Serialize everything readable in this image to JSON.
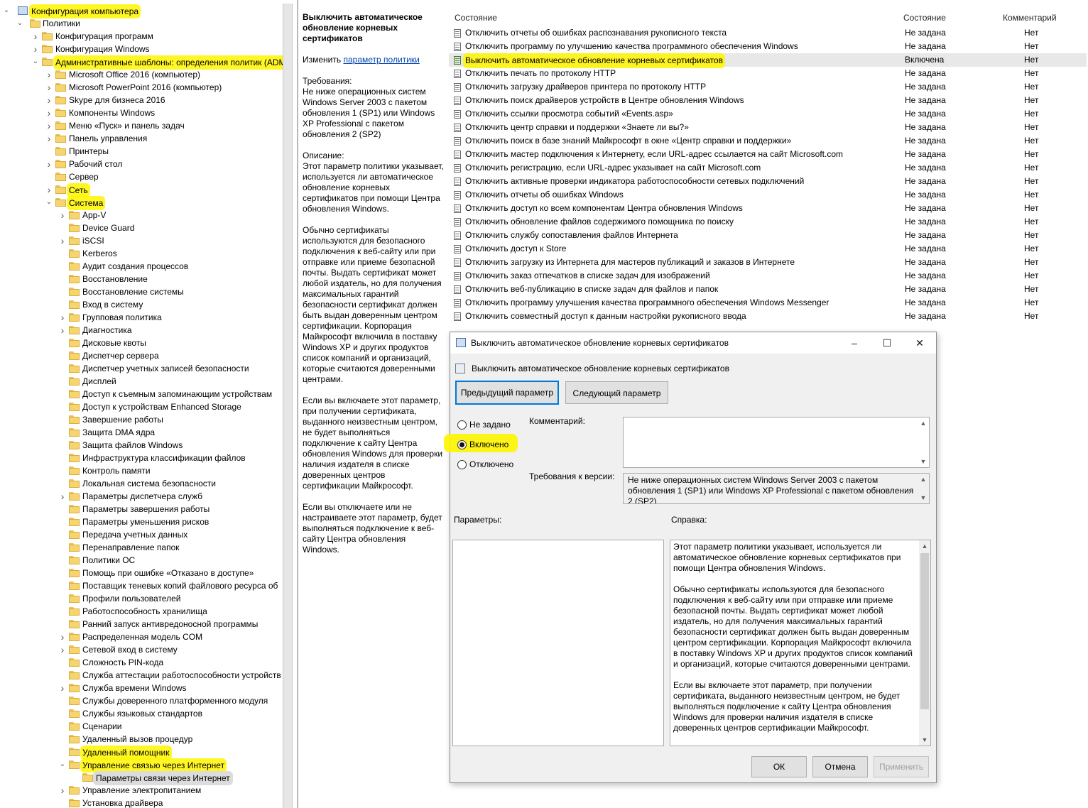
{
  "tree": {
    "root": "Конфигурация компьютера",
    "policies": "Политики",
    "items": [
      {
        "label": "Конфигурация программ",
        "level": 2,
        "chev": "right",
        "hl": false
      },
      {
        "label": "Конфигурация Windows",
        "level": 2,
        "chev": "right",
        "hl": false
      },
      {
        "label": "Административные шаблоны: определения политик (ADM",
        "level": 2,
        "chev": "down",
        "hl": true
      },
      {
        "label": "Microsoft Office 2016 (компьютер)",
        "level": 3,
        "chev": "right",
        "hl": false
      },
      {
        "label": "Microsoft PowerPoint 2016 (компьютер)",
        "level": 3,
        "chev": "right",
        "hl": false
      },
      {
        "label": "Skype для бизнеса 2016",
        "level": 3,
        "chev": "right",
        "hl": false
      },
      {
        "label": "Компоненты Windows",
        "level": 3,
        "chev": "right",
        "hl": false
      },
      {
        "label": "Меню «Пуск» и панель задач",
        "level": 3,
        "chev": "right",
        "hl": false
      },
      {
        "label": "Панель управления",
        "level": 3,
        "chev": "right",
        "hl": false
      },
      {
        "label": "Принтеры",
        "level": 3,
        "chev": "",
        "hl": false
      },
      {
        "label": "Рабочий стол",
        "level": 3,
        "chev": "right",
        "hl": false
      },
      {
        "label": "Сервер",
        "level": 3,
        "chev": "",
        "hl": false
      },
      {
        "label": "Сеть",
        "level": 3,
        "chev": "right",
        "hl": true
      },
      {
        "label": "Система",
        "level": 3,
        "chev": "down",
        "hl": true
      },
      {
        "label": "App-V",
        "level": 4,
        "chev": "right",
        "hl": false
      },
      {
        "label": "Device Guard",
        "level": 4,
        "chev": "",
        "hl": false
      },
      {
        "label": "iSCSI",
        "level": 4,
        "chev": "right",
        "hl": false
      },
      {
        "label": "Kerberos",
        "level": 4,
        "chev": "",
        "hl": false
      },
      {
        "label": "Аудит создания процессов",
        "level": 4,
        "chev": "",
        "hl": false
      },
      {
        "label": "Восстановление",
        "level": 4,
        "chev": "",
        "hl": false
      },
      {
        "label": "Восстановление системы",
        "level": 4,
        "chev": "",
        "hl": false
      },
      {
        "label": "Вход в систему",
        "level": 4,
        "chev": "",
        "hl": false
      },
      {
        "label": "Групповая политика",
        "level": 4,
        "chev": "right",
        "hl": false
      },
      {
        "label": "Диагностика",
        "level": 4,
        "chev": "right",
        "hl": false
      },
      {
        "label": "Дисковые квоты",
        "level": 4,
        "chev": "",
        "hl": false
      },
      {
        "label": "Диспетчер сервера",
        "level": 4,
        "chev": "",
        "hl": false
      },
      {
        "label": "Диспетчер учетных записей безопасности",
        "level": 4,
        "chev": "",
        "hl": false
      },
      {
        "label": "Дисплей",
        "level": 4,
        "chev": "",
        "hl": false
      },
      {
        "label": "Доступ к съемным запоминающим устройствам",
        "level": 4,
        "chev": "",
        "hl": false
      },
      {
        "label": "Доступ к устройствам Enhanced Storage",
        "level": 4,
        "chev": "",
        "hl": false
      },
      {
        "label": "Завершение работы",
        "level": 4,
        "chev": "",
        "hl": false
      },
      {
        "label": "Защита DMA ядра",
        "level": 4,
        "chev": "",
        "hl": false
      },
      {
        "label": "Защита файлов Windows",
        "level": 4,
        "chev": "",
        "hl": false
      },
      {
        "label": "Инфраструктура классификации файлов",
        "level": 4,
        "chev": "",
        "hl": false
      },
      {
        "label": "Контроль памяти",
        "level": 4,
        "chev": "",
        "hl": false
      },
      {
        "label": "Локальная система безопасности",
        "level": 4,
        "chev": "",
        "hl": false
      },
      {
        "label": "Параметры диспетчера служб",
        "level": 4,
        "chev": "right",
        "hl": false
      },
      {
        "label": "Параметры завершения работы",
        "level": 4,
        "chev": "",
        "hl": false
      },
      {
        "label": "Параметры уменьшения рисков",
        "level": 4,
        "chev": "",
        "hl": false
      },
      {
        "label": "Передача учетных данных",
        "level": 4,
        "chev": "",
        "hl": false
      },
      {
        "label": "Перенаправление папок",
        "level": 4,
        "chev": "",
        "hl": false
      },
      {
        "label": "Политики ОС",
        "level": 4,
        "chev": "",
        "hl": false
      },
      {
        "label": "Помощь при ошибке «Отказано в доступе»",
        "level": 4,
        "chev": "",
        "hl": false
      },
      {
        "label": "Поставщик теневых копий файлового ресурса об",
        "level": 4,
        "chev": "",
        "hl": false
      },
      {
        "label": "Профили пользователей",
        "level": 4,
        "chev": "",
        "hl": false
      },
      {
        "label": "Работоспособность хранилища",
        "level": 4,
        "chev": "",
        "hl": false
      },
      {
        "label": "Ранний запуск антивредоносной программы",
        "level": 4,
        "chev": "",
        "hl": false
      },
      {
        "label": "Распределенная модель COM",
        "level": 4,
        "chev": "right",
        "hl": false
      },
      {
        "label": "Сетевой вход в систему",
        "level": 4,
        "chev": "right",
        "hl": false
      },
      {
        "label": "Сложность PIN-кода",
        "level": 4,
        "chev": "",
        "hl": false
      },
      {
        "label": "Служба аттестации работоспособности устройств",
        "level": 4,
        "chev": "",
        "hl": false
      },
      {
        "label": "Служба времени Windows",
        "level": 4,
        "chev": "right",
        "hl": false
      },
      {
        "label": "Службы доверенного платформенного модуля",
        "level": 4,
        "chev": "",
        "hl": false
      },
      {
        "label": "Службы языковых стандартов",
        "level": 4,
        "chev": "",
        "hl": false
      },
      {
        "label": "Сценарии",
        "level": 4,
        "chev": "",
        "hl": false
      },
      {
        "label": "Удаленный вызов процедур",
        "level": 4,
        "chev": "",
        "hl": false
      },
      {
        "label": "Удаленный помощник",
        "level": 4,
        "chev": "",
        "hl": true
      },
      {
        "label": "Управление связью через Интернет",
        "level": 4,
        "chev": "down",
        "hl": true
      },
      {
        "label": "Параметры связи через Интернет",
        "level": 5,
        "chev": "",
        "hl": true,
        "sel": true
      },
      {
        "label": "Управление электропитанием",
        "level": 4,
        "chev": "right",
        "hl": false
      },
      {
        "label": "Установка драйвера",
        "level": 4,
        "chev": "",
        "hl": false
      }
    ]
  },
  "description": {
    "title": "Выключить автоматическое обновление корневых сертификатов",
    "edit_prefix": "Изменить",
    "edit_link": "параметр политики",
    "req_label": "Требования:",
    "req_text": "Не ниже операционных систем Windows Server 2003 с пакетом обновления 1 (SP1) или Windows XP Professional с пакетом обновления 2 (SP2)",
    "desc_label": "Описание:",
    "p1": "Этот параметр политики указывает, используется ли автоматическое обновление корневых сертификатов при помощи Центра обновления Windows.",
    "p2": "Обычно сертификаты используются для безопасного подключения к веб-сайту или при отправке или приеме безопасной почты. Выдать сертификат может любой издатель, но для получения максимальных гарантий безопасности сертификат должен быть выдан доверенным центром сертификации. Корпорация Майкрософт включила в поставку Windows XP и других продуктов список компаний и организаций, которые считаются доверенными центрами.",
    "p3": "Если вы включаете этот параметр, при получении сертификата, выданного неизвестным центром, не будет выполняться подключение к сайту Центра обновления Windows для проверки наличия издателя в списке доверенных центров сертификации Майкрософт.",
    "p4": "Если вы отключаете или не настраиваете этот параметр, будет выполняться подключение к веб-сайту Центра обновления Windows."
  },
  "list": {
    "headers": {
      "name": "Состояние",
      "state": "Состояние",
      "comment": "Комментарий"
    },
    "rows": [
      {
        "name": "Отключить отчеты об ошибках распознавания рукописного текста",
        "state": "Не задана",
        "comment": "Нет"
      },
      {
        "name": "Отключить программу по улучшению качества программного обеспечения Windows",
        "state": "Не задана",
        "comment": "Нет"
      },
      {
        "name": "Выключить автоматическое обновление корневых сертификатов",
        "state": "Включена",
        "comment": "Нет",
        "selected": true
      },
      {
        "name": "Отключить печать по протоколу HTTP",
        "state": "Не задана",
        "comment": "Нет"
      },
      {
        "name": "Отключить загрузку драйверов принтера по протоколу HTTP",
        "state": "Не задана",
        "comment": "Нет"
      },
      {
        "name": "Отключить поиск драйверов устройств в Центре обновления Windows",
        "state": "Не задана",
        "comment": "Нет"
      },
      {
        "name": "Отключить ссылки просмотра событий «Events.asp»",
        "state": "Не задана",
        "comment": "Нет"
      },
      {
        "name": "Отключить центр справки и поддержки «Знаете ли вы?»",
        "state": "Не задана",
        "comment": "Нет"
      },
      {
        "name": "Отключить поиск в базе знаний Майкрософт в окне «Центр справки и поддержки»",
        "state": "Не задана",
        "comment": "Нет"
      },
      {
        "name": "Отключить мастер подключения к Интернету, если URL-адрес ссылается на сайт Microsoft.com",
        "state": "Не задана",
        "comment": "Нет"
      },
      {
        "name": "Отключить регистрацию, если URL-адрес указывает на сайт Microsoft.com",
        "state": "Не задана",
        "comment": "Нет"
      },
      {
        "name": "Отключить активные проверки индикатора работоспособности сетевых подключений",
        "state": "Не задана",
        "comment": "Нет"
      },
      {
        "name": "Отключить отчеты об ошибках Windows",
        "state": "Не задана",
        "comment": "Нет"
      },
      {
        "name": "Отключить доступ ко всем компонентам Центра обновления Windows",
        "state": "Не задана",
        "comment": "Нет"
      },
      {
        "name": "Отключить обновление файлов содержимого помощника по поиску",
        "state": "Не задана",
        "comment": "Нет"
      },
      {
        "name": "Отключить службу сопоставления файлов Интернета",
        "state": "Не задана",
        "comment": "Нет"
      },
      {
        "name": "Отключить доступ к Store",
        "state": "Не задана",
        "comment": "Нет"
      },
      {
        "name": "Отключить загрузку из Интернета для мастеров публикаций и заказов в Интернете",
        "state": "Не задана",
        "comment": "Нет"
      },
      {
        "name": "Отключить заказ отпечатков в списке задач для изображений",
        "state": "Не задана",
        "comment": "Нет"
      },
      {
        "name": "Отключить веб-публикацию в списке задач для файлов и папок",
        "state": "Не задана",
        "comment": "Нет"
      },
      {
        "name": "Отключить программу улучшения качества программного обеспечения Windows Messenger",
        "state": "Не задана",
        "comment": "Нет"
      },
      {
        "name": "Отключить совместный доступ к данным настройки рукописного ввода",
        "state": "Не задана",
        "comment": "Нет"
      }
    ]
  },
  "dialog": {
    "title": "Выключить автоматическое обновление корневых сертификатов",
    "subtitle": "Выключить автоматическое обновление корневых сертификатов",
    "prev": "Предыдущий параметр",
    "next": "Следующий параметр",
    "radio_not_configured": "Не задано",
    "radio_enabled": "Включено",
    "radio_disabled": "Отключено",
    "selected_option": "Включено",
    "comment_label": "Комментарий:",
    "comment_value": "",
    "version_label": "Требования к версии:",
    "version_text": "Не ниже операционных систем Windows Server 2003 с пакетом обновления 1 (SP1) или Windows XP Professional с пакетом обновления 2 (SP2)",
    "params_label": "Параметры:",
    "help_label": "Справка:",
    "help_p1": "Этот параметр политики указывает, используется ли автоматическое обновление корневых сертификатов при помощи Центра обновления Windows.",
    "help_p2": "Обычно сертификаты используются для безопасного подключения к веб-сайту или при отправке или приеме безопасной почты. Выдать сертификат может любой издатель, но для получения максимальных гарантий безопасности сертификат должен быть выдан доверенным центром сертификации. Корпорация Майкрософт включила в поставку Windows XP и других продуктов список компаний и организаций, которые считаются доверенными центрами.",
    "help_p3": "Если вы включаете этот параметр, при получении сертификата, выданного неизвестным центром, не будет выполняться подключение к сайту Центра обновления Windows для проверки наличия издателя в списке доверенных центров сертификации Майкрософт.",
    "ok": "ОК",
    "cancel": "Отмена",
    "apply": "Применить"
  },
  "colors": {
    "highlight": "#fff500",
    "focus_border": "#0078d7"
  }
}
